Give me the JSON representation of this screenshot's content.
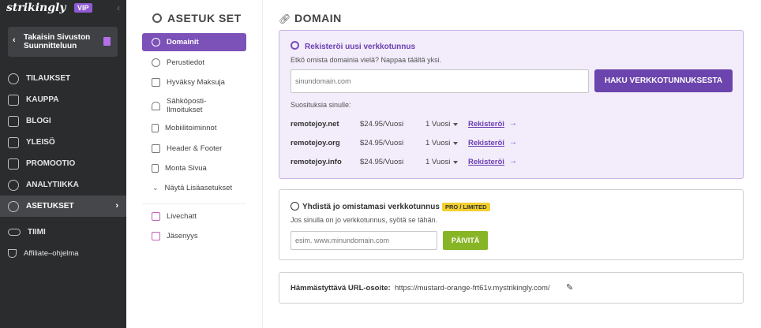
{
  "app": {
    "logo": "strikingly",
    "vip_badge": "VIP",
    "collapse_icon": "chevron-left-icon"
  },
  "back_button": {
    "label": "Takaisin Sivuston Suunnitteluun"
  },
  "left_nav": [
    {
      "label": "TILAUKSET",
      "icon": "dollar-circle-icon"
    },
    {
      "label": "KAUPPA",
      "icon": "store-icon"
    },
    {
      "label": "BLOGI",
      "icon": "pen-icon"
    },
    {
      "label": "YLEISÖ",
      "icon": "people-icon"
    },
    {
      "label": "PROMOOTIO",
      "icon": "megaphone-icon"
    },
    {
      "label": "ANALYTIIKKA",
      "icon": "chart-pie-icon"
    },
    {
      "label": "ASETUKSET",
      "icon": "gear-icon",
      "active": true
    },
    {
      "label": "TIIMI",
      "icon": "team-toggle-icon"
    },
    {
      "label": "Affiliate–ohjelma",
      "icon": "trophy-icon"
    }
  ],
  "settings": {
    "title": "ASETUK SET",
    "items": [
      {
        "label": "Domainit",
        "icon": "globe-icon",
        "active": true
      },
      {
        "label": "Perustiedot",
        "icon": "info-icon"
      },
      {
        "label": "Hyväksy Maksuja",
        "icon": "credit-card-icon"
      },
      {
        "label": "Sähköposti-Ilmoitukset",
        "icon": "bell-icon"
      },
      {
        "label": "Mobiilitoiminnot",
        "icon": "mobile-icon"
      },
      {
        "label": "Header & Footer",
        "icon": "layout-icon"
      },
      {
        "label": "Monta Sivua",
        "icon": "pages-icon"
      },
      {
        "label": "Näytä Lisäasetukset",
        "icon": "chevron-down-icon"
      },
      {
        "label": "Livechatt",
        "icon": "chat-icon"
      },
      {
        "label": "Jäsenyys",
        "icon": "member-icon"
      }
    ]
  },
  "domain": {
    "title": "DOMAIN",
    "register": {
      "title": "Rekisteröi uusi verkkotunnus",
      "subtitle": "Etkö omista domainia vielä? Nappaa täältä yksi.",
      "input_placeholder": "sinundomain.com",
      "search_button": "HAKU VERKKOTUNNUKSESTA",
      "suggestions_label": "Suosituksia sinulle:",
      "suggestions": [
        {
          "domain": "remotejoy.net",
          "price": "$24.95/Vuosi",
          "years": "1 Vuosi",
          "action": "Rekisteröi"
        },
        {
          "domain": "remotejoy.org",
          "price": "$24.95/Vuosi",
          "years": "1 Vuosi",
          "action": "Rekisteröi"
        },
        {
          "domain": "remotejoy.info",
          "price": "$24.95/Vuosi",
          "years": "1 Vuosi",
          "action": "Rekisteröi"
        }
      ]
    },
    "connect": {
      "title": "Yhdistä jo omistamasi verkkotunnus",
      "badge": "PRO / LIMITED",
      "subtitle": "Jos sinulla on jo verkkotunnus, syötä se tähän.",
      "input_placeholder": "esim. www.minundomain.com",
      "update_button": "PÄIVITÄ"
    },
    "url": {
      "label": "Hämmästyttävä URL-osoite:",
      "value": "https://mustard-orange-frt61v.mystrikingly.com/"
    }
  }
}
